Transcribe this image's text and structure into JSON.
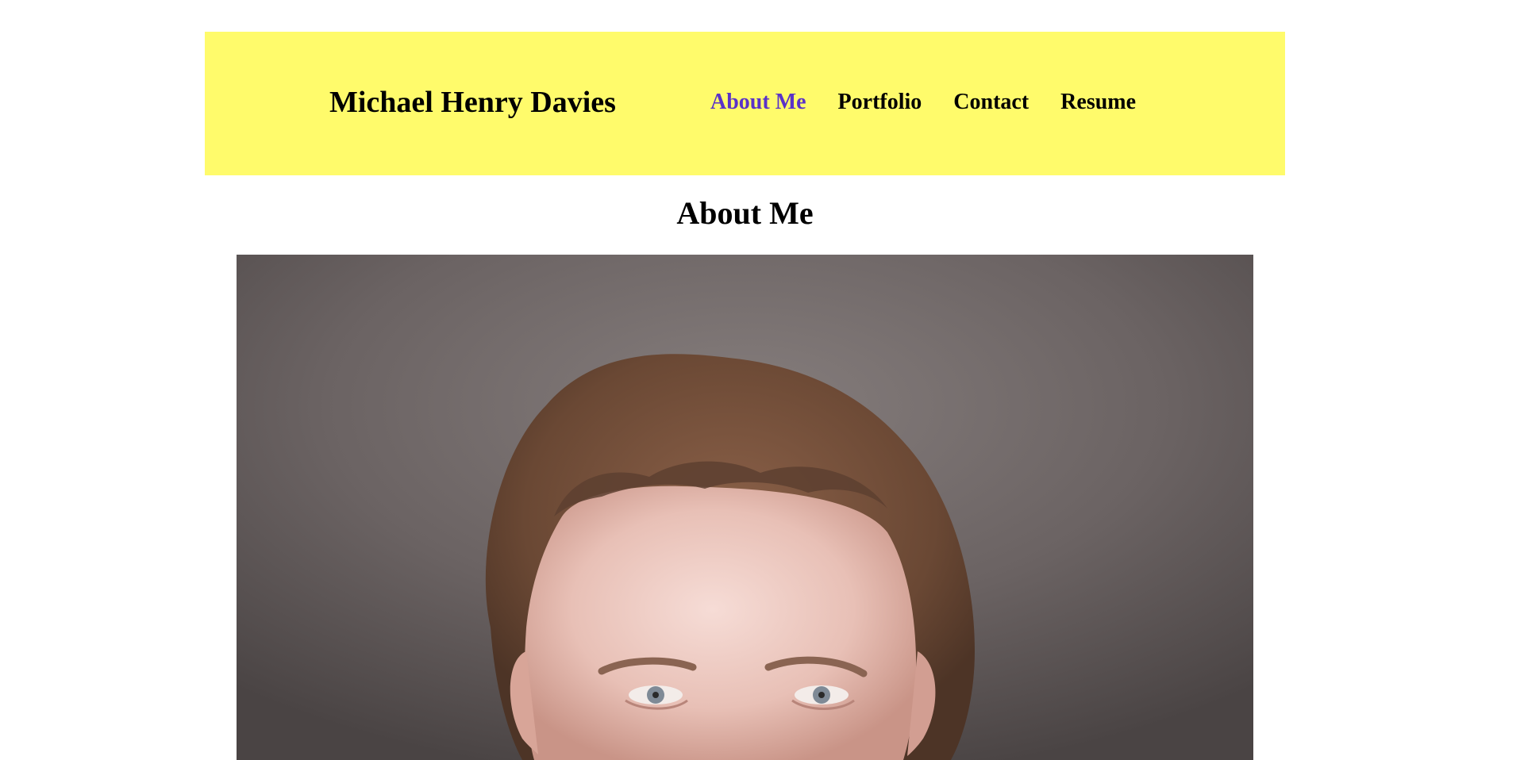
{
  "header": {
    "site_title": "Michael Henry Davies",
    "nav": [
      {
        "label": "About Me",
        "active": true
      },
      {
        "label": "Portfolio",
        "active": false
      },
      {
        "label": "Contact",
        "active": false
      },
      {
        "label": "Resume",
        "active": false
      }
    ],
    "background_color": "#fffb6b",
    "active_link_color": "#5a32c8"
  },
  "main": {
    "section_title": "About Me",
    "photo": {
      "kind": "portrait-photo"
    }
  }
}
